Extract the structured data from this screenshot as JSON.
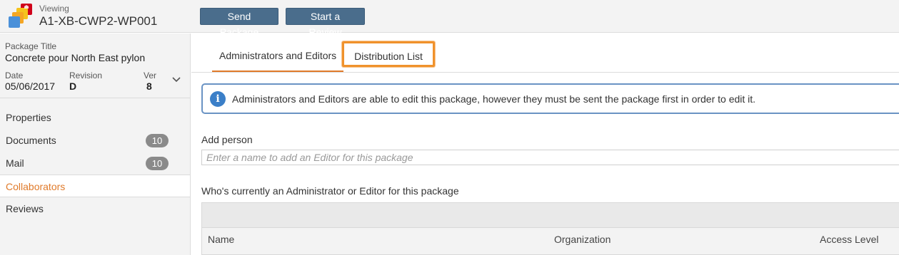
{
  "header": {
    "viewing_label": "Viewing",
    "package_id": "A1-XB-CWP2-WP001",
    "send_label": "Send Package",
    "review_label": "Start a Review"
  },
  "package": {
    "title_label": "Package Title",
    "title": "Concrete pour North East pylon",
    "date_label": "Date",
    "date": "05/06/2017",
    "revision_label": "Revision",
    "revision": "D",
    "ver_label": "Ver",
    "ver": "8"
  },
  "sidebar": {
    "items": [
      {
        "label": "Properties",
        "badge": ""
      },
      {
        "label": "Documents",
        "badge": "10"
      },
      {
        "label": "Mail",
        "badge": "10"
      },
      {
        "label": "Collaborators",
        "badge": ""
      },
      {
        "label": "Reviews",
        "badge": ""
      }
    ]
  },
  "tabs": {
    "admin": "Administrators and Editors",
    "distribution": "Distribution List"
  },
  "info": {
    "text": "Administrators and Editors are able to edit this package, however they must be sent the package first in order to edit it."
  },
  "add_person": {
    "label": "Add person",
    "placeholder": "Enter a name to add an Editor for this package"
  },
  "current": {
    "label": "Who's currently an Administrator or Editor for this package"
  },
  "table": {
    "columns": [
      "Name",
      "Organization",
      "Access Level"
    ]
  },
  "colors": {
    "accent": "#e07a2a",
    "button": "#4a6d8c",
    "info_border": "#6a93c4"
  }
}
